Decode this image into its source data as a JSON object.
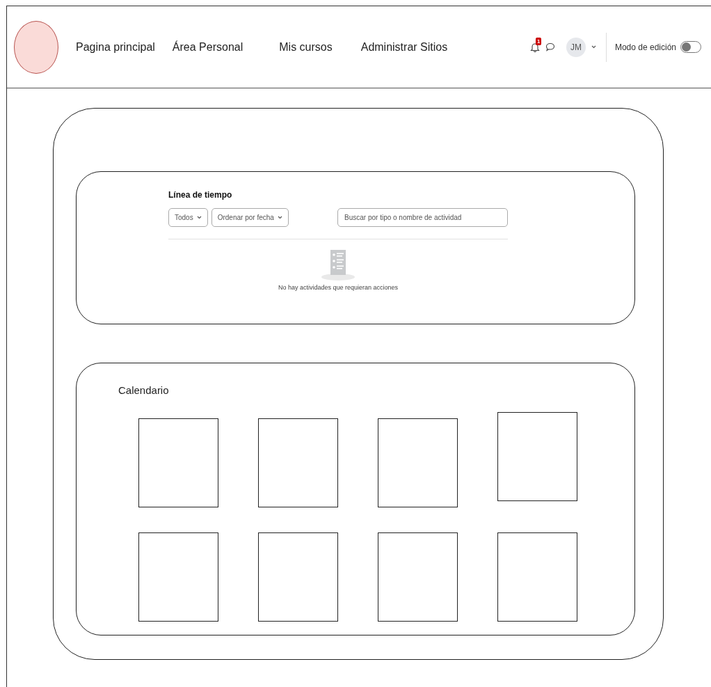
{
  "header": {
    "nav": [
      {
        "label": "Pagina principal"
      },
      {
        "label": "Área Personal"
      },
      {
        "label": "Mis cursos"
      },
      {
        "label": "Administrar Sitios"
      }
    ],
    "notifications": "1",
    "avatar": "JM",
    "edit_mode": {
      "label": "Modo de edición",
      "on": false
    }
  },
  "timeline": {
    "title": "Línea de tiempo",
    "filters": [
      {
        "label": "Todos"
      },
      {
        "label": "Ordenar por fecha"
      }
    ],
    "search": {
      "placeholder": "Buscar por tipo o nombre de actividad"
    },
    "empty_message": "No hay actividades que requieran acciones"
  },
  "calendar": {
    "title": "Calendario",
    "cells": [
      {
        "kind": "box"
      },
      {
        "kind": "box"
      },
      {
        "kind": "box"
      },
      {
        "kind": "raised"
      },
      {
        "kind": "box"
      },
      {
        "kind": "box"
      },
      {
        "kind": "box"
      },
      {
        "kind": "box"
      }
    ]
  }
}
